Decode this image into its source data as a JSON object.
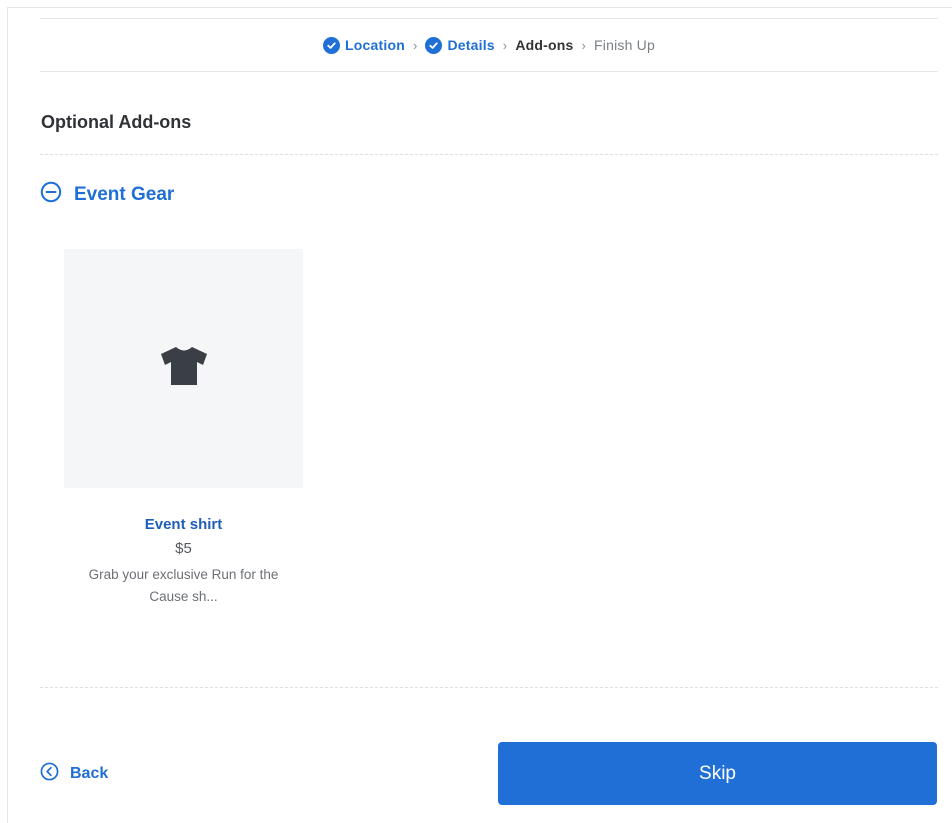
{
  "stepper": {
    "steps": [
      {
        "label": "Location",
        "state": "done"
      },
      {
        "label": "Details",
        "state": "done"
      },
      {
        "label": "Add-ons",
        "state": "current"
      },
      {
        "label": "Finish Up",
        "state": "future"
      }
    ],
    "separator": "›"
  },
  "section": {
    "title": "Optional Add-ons"
  },
  "group": {
    "label": "Event Gear",
    "icon": "minus-circle-icon"
  },
  "products": [
    {
      "name": "Event shirt",
      "price": "$5",
      "description": "Grab your exclusive Run for the Cause sh...",
      "icon": "tshirt-icon"
    }
  ],
  "footer": {
    "back_label": "Back",
    "skip_label": "Skip"
  },
  "colors": {
    "accent": "#1f6fd6",
    "text": "#333333",
    "muted": "#7b7f85",
    "card_bg": "#f5f6f8"
  }
}
